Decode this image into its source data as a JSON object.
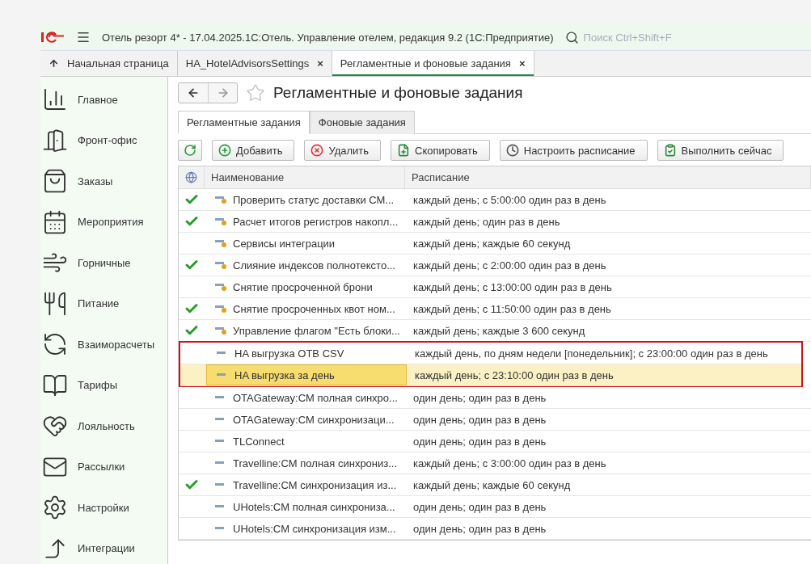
{
  "window": {
    "title": "Отель резорт 4* - 17.04.2025.1С:Отель. Управление отелем, редакция 9.2  (1С:Предприятие)",
    "search": {
      "placeholder": "Поиск Ctrl+Shift+F"
    }
  },
  "open_tabs": [
    {
      "label": "Начальная страница",
      "kind": "home",
      "selected": false
    },
    {
      "label": "HA_HotelAdvisorsSettings",
      "kind": "closable",
      "close": "×",
      "selected": false
    },
    {
      "label": "Регламентные и фоновые задания",
      "kind": "closable",
      "close": "×",
      "selected": true
    }
  ],
  "sidebar": {
    "items": [
      {
        "label": "Главное"
      },
      {
        "label": "Фронт-офис"
      },
      {
        "label": "Заказы"
      },
      {
        "label": "Мероприятия"
      },
      {
        "label": "Горничные"
      },
      {
        "label": "Питание"
      },
      {
        "label": "Взаиморасчеты"
      },
      {
        "label": "Тарифы"
      },
      {
        "label": "Лояльность"
      },
      {
        "label": "Рассылки"
      },
      {
        "label": "Настройки"
      },
      {
        "label": "Интеграции"
      }
    ]
  },
  "page": {
    "title": "Регламентные и фоновые задания",
    "favorite": false
  },
  "sub_tabs": [
    {
      "label": "Регламентные задания",
      "selected": true
    },
    {
      "label": "Фоновые задания",
      "selected": false
    }
  ],
  "toolbar": [
    {
      "kind": "refresh"
    },
    {
      "kind": "add",
      "label": "Добавить"
    },
    {
      "kind": "delete",
      "label": "Удалить"
    },
    {
      "kind": "copy",
      "label": "Скопировать"
    },
    {
      "kind": "schedule",
      "label": "Настроить расписание"
    },
    {
      "kind": "run",
      "label": "Выполнить сейчас"
    }
  ],
  "table": {
    "columns": [
      "Наименование",
      "Расписание"
    ],
    "rows": [
      {
        "checked": true,
        "kind": "predefined",
        "name": "Проверить статус доставки СМ...",
        "schedule": "каждый день; с 5:00:00 один раз в день",
        "selected": false,
        "outlined": false
      },
      {
        "checked": true,
        "kind": "predefined",
        "name": "Расчет итогов регистров накопл...",
        "schedule": "каждый день; один раз в день",
        "selected": false,
        "outlined": false
      },
      {
        "checked": false,
        "kind": "predefined",
        "name": "Сервисы интеграции",
        "schedule": "каждый день; каждые 60 секунд",
        "selected": false,
        "outlined": false
      },
      {
        "checked": true,
        "kind": "predefined",
        "name": "Слияние индексов полнотексто...",
        "schedule": "каждый день; с 2:00:00 один раз в день",
        "selected": false,
        "outlined": false
      },
      {
        "checked": false,
        "kind": "predefined",
        "name": "Снятие просроченной брони",
        "schedule": "каждый день; с 13:00:00 один раз в день",
        "selected": false,
        "outlined": false
      },
      {
        "checked": true,
        "kind": "predefined",
        "name": "Снятие просроченных квот ном...",
        "schedule": "каждый день; с 11:50:00 один раз в день",
        "selected": false,
        "outlined": false
      },
      {
        "checked": true,
        "kind": "predefined",
        "name": "Управление флагом \"Есть блоки...",
        "schedule": "каждый день; каждые 3 600 секунд",
        "selected": false,
        "outlined": false
      },
      {
        "checked": false,
        "kind": "custom",
        "name": "HA выгрузка OTB CSV",
        "schedule": "каждый день, по дням недели [понедельник]; с 23:00:00 один раз в день",
        "selected": false,
        "outlined": true
      },
      {
        "checked": false,
        "kind": "custom",
        "name": "HA выгрузка за день",
        "schedule": "каждый день; с 23:10:00 один раз в день",
        "selected": true,
        "outlined": true
      },
      {
        "checked": false,
        "kind": "custom",
        "name": "OTAGateway:CM полная синхро...",
        "schedule": "один день; один раз в день",
        "selected": false,
        "outlined": false
      },
      {
        "checked": false,
        "kind": "custom",
        "name": "OTAGateway:CM синхронизаци...",
        "schedule": "один день; один раз в день",
        "selected": false,
        "outlined": false
      },
      {
        "checked": false,
        "kind": "custom",
        "name": "TLConnect",
        "schedule": "один день; один раз в день",
        "selected": false,
        "outlined": false
      },
      {
        "checked": false,
        "kind": "custom",
        "name": "Travelline:CM полная синхрониз...",
        "schedule": "каждый день; с 3:00:00 один раз в день",
        "selected": false,
        "outlined": false
      },
      {
        "checked": true,
        "kind": "custom",
        "name": "Travelline:CM синхронизация из...",
        "schedule": "каждый день; каждые 60 секунд",
        "selected": false,
        "outlined": false
      },
      {
        "checked": false,
        "kind": "custom",
        "name": "UHotels:CM полная синхрониза...",
        "schedule": "один день; один раз в день",
        "selected": false,
        "outlined": false
      },
      {
        "checked": false,
        "kind": "custom",
        "name": "UHotels:CM синхронизация изм...",
        "schedule": "один день; один раз в день",
        "selected": false,
        "outlined": false
      }
    ]
  }
}
